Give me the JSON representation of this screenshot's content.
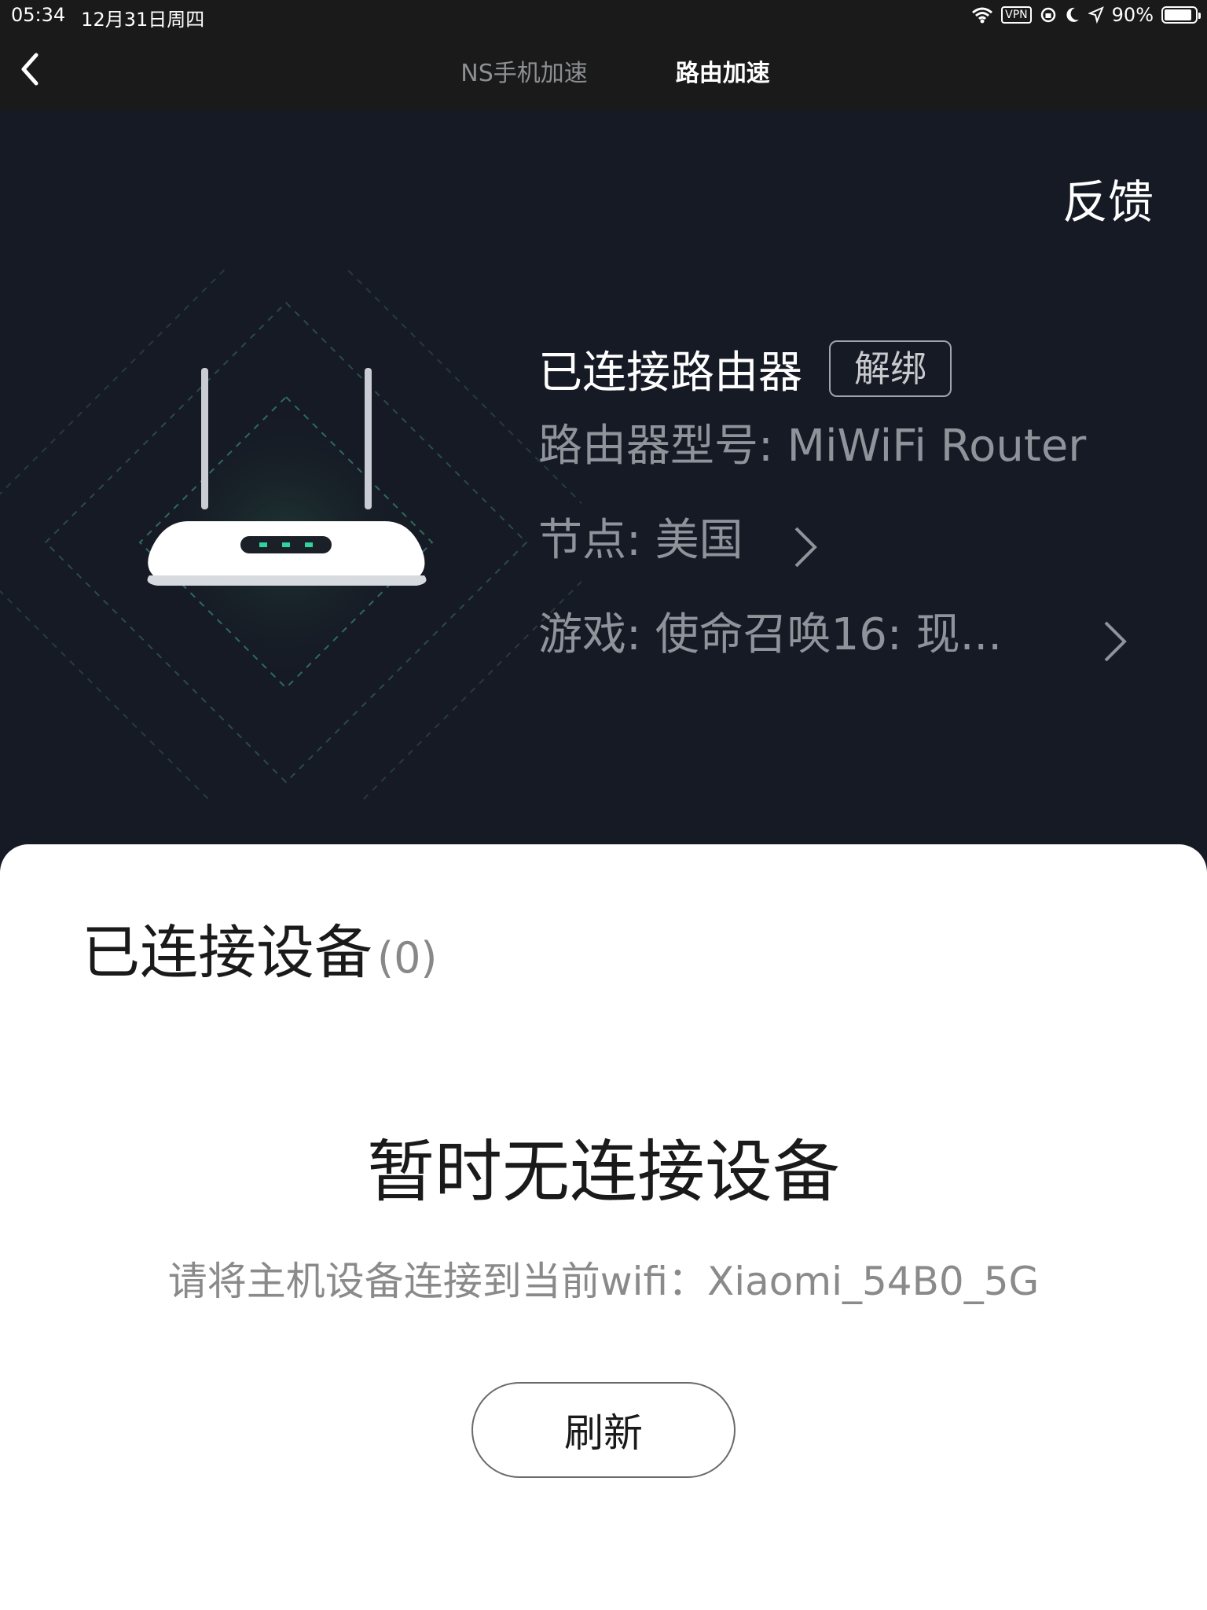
{
  "status_bar": {
    "time": "05:34",
    "date": "12月31日周四",
    "vpn_label": "VPN",
    "battery": "90%",
    "battery_level": 0.9
  },
  "nav": {
    "tabs": [
      {
        "label": "NS手机加速",
        "active": false
      },
      {
        "label": "路由加速",
        "active": true
      }
    ]
  },
  "hero": {
    "feedback_label": "反馈",
    "router_title": "已连接路由器",
    "unbind_label": "解绑",
    "model_text": "路由器型号: MiWiFi Router",
    "node_text": "节点: 美国",
    "game_text": "游戏: 使命召唤16: 现..."
  },
  "devices": {
    "title": "已连接设备",
    "count": "(0)",
    "empty_title": "暂时无连接设备",
    "empty_hint": "请将主机设备连接到当前wifi：Xiaomi_54B0_5G",
    "refresh_label": "刷新"
  },
  "colors": {
    "hero_bg": "#161a24",
    "nav_bg": "#1a1a1a",
    "accent_green": "#2ed3a0"
  },
  "icons": [
    "back-chevron-icon",
    "wifi-icon",
    "vpn-icon",
    "rotation-lock-icon",
    "moon-icon",
    "location-arrow-icon",
    "battery-icon",
    "router-icon",
    "chevron-right-icon"
  ]
}
